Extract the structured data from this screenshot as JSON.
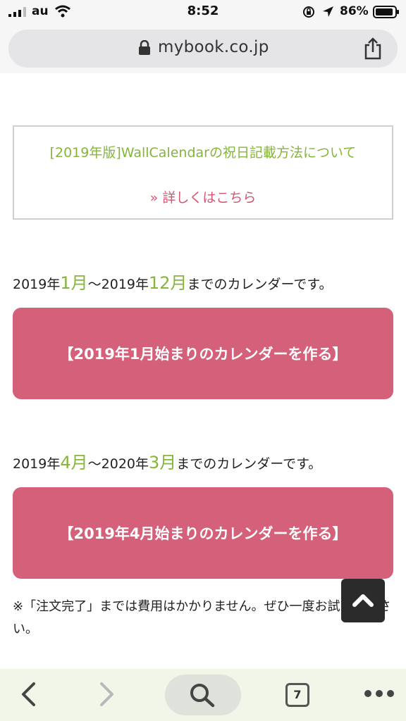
{
  "status_bar": {
    "carrier": "au",
    "time": "8:52",
    "battery_percent": "86%",
    "icons": [
      "signal-icon",
      "wifi-icon",
      "orientation-lock-icon",
      "location-icon",
      "battery-icon"
    ]
  },
  "browser": {
    "url": "mybook.co.jp",
    "tab_count": "7",
    "icons": [
      "lock-icon",
      "share-icon",
      "back-icon",
      "forward-icon",
      "search-icon",
      "tabs-icon",
      "more-icon"
    ]
  },
  "notice": {
    "title": "[2019年版]WallCalendarの祝日記載方法について",
    "link": "» 詳しくはこちら"
  },
  "calendars": [
    {
      "range_start_year": "2019年",
      "range_start_month": "1月",
      "range_sep": "～2019年",
      "range_end_month": "12月",
      "range_suffix": "までのカレンダーです。",
      "button_label": "【2019年1月始まりのカレンダーを作る】"
    },
    {
      "range_start_year": "2019年",
      "range_start_month": "4月",
      "range_sep": "～2020年",
      "range_end_month": "3月",
      "range_suffix": "までのカレンダーです。",
      "button_label": "【2019年4月始まりのカレンダーを作る】"
    }
  ],
  "footnote": "※「注文完了」までは費用はかかりません。ぜひ一度お試しください。",
  "colors": {
    "accent_green": "#85b53a",
    "link_pink": "#d4576f",
    "button_pink": "#d4607a",
    "toolbar_bg": "#f1f6e8"
  }
}
